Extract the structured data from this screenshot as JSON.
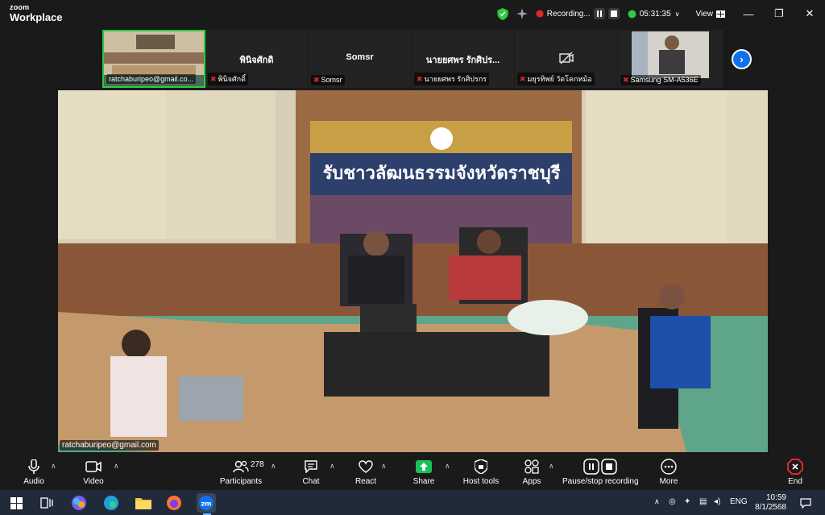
{
  "app": {
    "brand_small": "zoom",
    "brand_big": "Workplace"
  },
  "titlebar": {
    "recording_label": "Recording...",
    "elapsed": "05:31:35",
    "view_label": "View"
  },
  "participants_strip": [
    {
      "name": "",
      "caption": "ratchaburipeo@gmail.co...",
      "muted": false,
      "active": true
    },
    {
      "name": "พินิจศักดิ",
      "caption": "พินิจศักดิ์",
      "muted": true
    },
    {
      "name": "Somsr",
      "caption": "Somsr",
      "muted": true
    },
    {
      "name": "นายยศพร รักศิปร...",
      "caption": "นายยศพร รักศิปรกร",
      "muted": true
    },
    {
      "name": "",
      "caption": "มยุรทิพย์ วัดโคกหม้อ",
      "muted": true,
      "video_off": true
    },
    {
      "name": "",
      "caption": "Samsung SM-A536E",
      "muted": true
    }
  ],
  "main_video": {
    "caption": "ratchaburipeo@gmail.com",
    "banner_text": "รับชาวลัฒนธรรมจังหวัดราชบุรี"
  },
  "toolbar": {
    "audio": "Audio",
    "video": "Video",
    "participants": "Participants",
    "participants_count": "278",
    "chat": "Chat",
    "react": "React",
    "share": "Share",
    "host_tools": "Host tools",
    "apps": "Apps",
    "pause_recording": "Pause/stop recording",
    "more": "More",
    "end": "End"
  },
  "taskbar": {
    "lang": "ENG",
    "time": "10:59",
    "date": "8/1/2568"
  },
  "colors": {
    "accent": "#0e72ed",
    "share": "#19c15a",
    "end": "#e02828",
    "active_border": "#2ecc40"
  }
}
